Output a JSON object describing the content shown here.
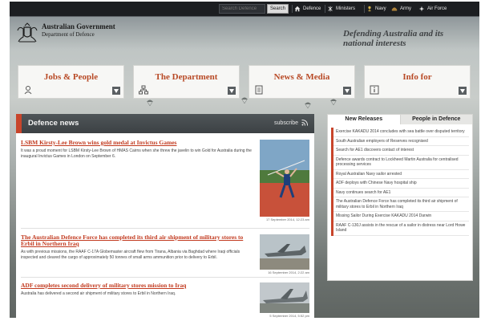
{
  "topbar": {
    "search_placeholder": "Search Defence",
    "search_button": "Search",
    "links": [
      "Defence",
      "Ministers",
      "Navy",
      "Army",
      "Air Force"
    ]
  },
  "header": {
    "org_line1": "Australian Government",
    "org_line2": "Department of Defence",
    "tagline": "Defending Australia and its national interests"
  },
  "menu": [
    "Jobs & People",
    "The Department",
    "News & Media",
    "Info for"
  ],
  "news": {
    "title": "Defence news",
    "subscribe": "subscribe",
    "stories": [
      {
        "headline": "LSBM Kirsty-Lee Brown wins gold medal at Invictus Games",
        "summary": "It was a proud moment for LSBM Kirsty-Lee Brown of HMAS Cairns when she threw the javelin to win Gold for Australia during the inaugural Invictus Games in London on September 6.",
        "timestamp": "17 September 2014, 12:23 am"
      },
      {
        "headline": "The Australian Defence Force has completed its third air shipment of military stores to Erbil in Northern Iraq",
        "summary": "As with previous missions, the RAAF C-17A Globemaster aircraft flew from Tirana, Albania via Baghdad where Iraqi officials inspected and cleared the cargo of approximately 50 tonnes of small arms ammunition prior to delivery to Erbil.",
        "timestamp": "16 September 2014, 2:22 am"
      },
      {
        "headline": "ADF completes second delivery of military stores mission to Iraq",
        "summary": "Australia has delivered a second air shipment of military stores to Erbil in Northern Iraq.",
        "timestamp": "5 September 2014, 5:52 pm"
      }
    ]
  },
  "side": {
    "tabs": [
      "New Releases",
      "People in Defence"
    ],
    "items": [
      "Exercise KAKADU 2014 concludes with sea battle over disputed territory",
      "South Australian employers of Reserves recognised",
      "Search for AE1 discovers contact of interest",
      "Defence awards contract to Lockheed Martin Australia for centralised processing services",
      "Royal Australian Navy sailor arrested",
      "ADF deploys with Chinese Navy hospital ship",
      "Navy continues search for AE1",
      "The Australian Defence Force has completed its third air shipment of military stores to Erbil in Northern Iraq",
      "Missing Sailor During Exercise KAKADU 2014 Darwin",
      "RAAF C-130J assists in the rescue of a sailor in distress near Lord Howe Island"
    ]
  },
  "colors": {
    "accent": "#c8452b",
    "headline": "#c23a1f",
    "dark_bar": "#1c1e21"
  }
}
